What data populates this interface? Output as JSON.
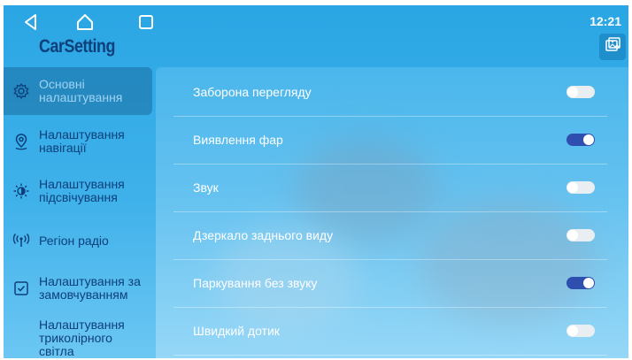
{
  "app_title": "CarSetting",
  "clock": "12:21",
  "nav": {
    "back_icon": "back-triangle-icon",
    "home_icon": "home-icon",
    "recents_icon": "recents-square-icon",
    "gallery_icon": "gallery-icon"
  },
  "sidebar": {
    "items": [
      {
        "label": "Основні налаштування",
        "icon": "gear-icon",
        "active": true
      },
      {
        "label": "Налаштування навігації",
        "icon": "location-pin-icon",
        "active": false
      },
      {
        "label": "Налаштування підсвічування",
        "icon": "brightness-icon",
        "active": false
      },
      {
        "label": "Регіон радіо",
        "icon": "radio-antenna-icon",
        "active": false
      },
      {
        "label": "Налаштування за замовчуванням",
        "icon": "checkbox-icon",
        "active": false
      },
      {
        "label": "Налаштування триколірного світла",
        "icon": "",
        "active": false
      }
    ]
  },
  "settings": [
    {
      "label": "Заборона перегляду",
      "on": false
    },
    {
      "label": "Виявлення фар",
      "on": true
    },
    {
      "label": "Звук",
      "on": false
    },
    {
      "label": "Дзеркало заднього виду",
      "on": false
    },
    {
      "label": "Паркування без звуку",
      "on": true
    },
    {
      "label": "Швидкий дотик",
      "on": false
    }
  ],
  "colors": {
    "accent": "#2f4fb0",
    "title": "#0d3f7a",
    "background": "#2aa6e4"
  }
}
